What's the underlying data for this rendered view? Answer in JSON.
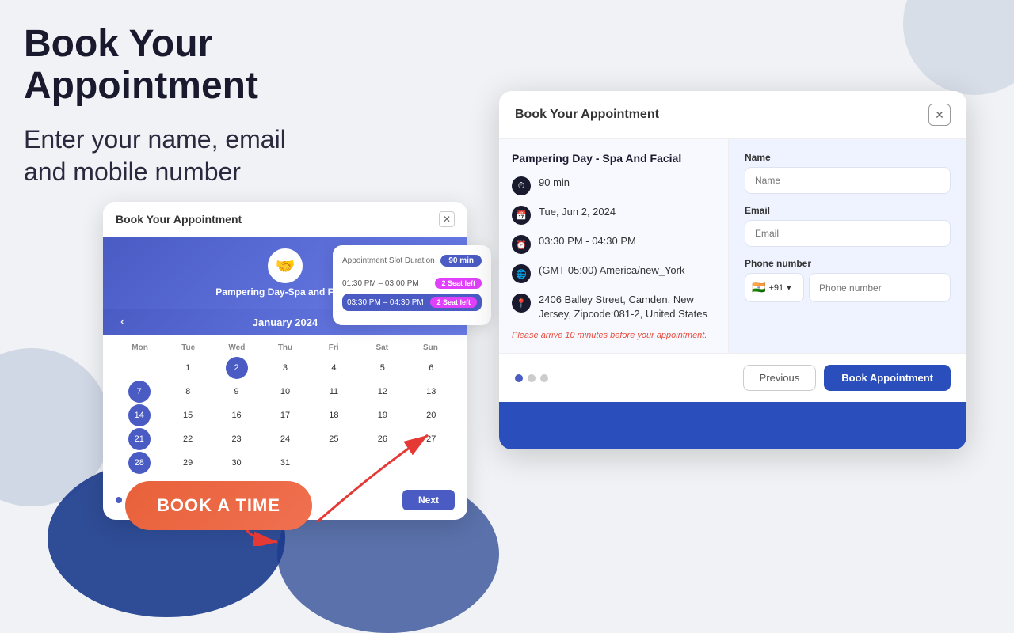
{
  "page": {
    "main_title": "Book Your Appointment",
    "sub_title": "Enter your name, email\nand mobile number",
    "book_btn": "BOOK A TIME"
  },
  "modal_left": {
    "title": "Book Your Appointment",
    "service_name": "Pampering Day-Spa and Facial",
    "month": "January  2024",
    "days_header": [
      "Mon",
      "Tue",
      "Wed",
      "Thu",
      "Fri",
      "Sat",
      "Sun"
    ],
    "days": [
      {
        "n": "",
        "selected": false,
        "highlighted": false
      },
      {
        "n": "1",
        "selected": false,
        "highlighted": false
      },
      {
        "n": "2",
        "selected": true,
        "highlighted": false
      },
      {
        "n": "3",
        "selected": false,
        "highlighted": false
      },
      {
        "n": "4",
        "selected": false,
        "highlighted": false
      },
      {
        "n": "5",
        "selected": false,
        "highlighted": false
      },
      {
        "n": "6",
        "selected": false,
        "highlighted": false
      },
      {
        "n": "7",
        "selected": false,
        "highlighted": true
      },
      {
        "n": "8",
        "selected": false,
        "highlighted": false
      },
      {
        "n": "9",
        "selected": false,
        "highlighted": false
      },
      {
        "n": "10",
        "selected": false,
        "highlighted": false
      },
      {
        "n": "11",
        "selected": false,
        "highlighted": false
      },
      {
        "n": "12",
        "selected": false,
        "highlighted": false
      },
      {
        "n": "13",
        "selected": false,
        "highlighted": false
      },
      {
        "n": "14",
        "selected": false,
        "highlighted": true
      },
      {
        "n": "15",
        "selected": false,
        "highlighted": false
      },
      {
        "n": "16",
        "selected": false,
        "highlighted": false
      },
      {
        "n": "17",
        "selected": false,
        "highlighted": false
      },
      {
        "n": "18",
        "selected": false,
        "highlighted": false
      },
      {
        "n": "19",
        "selected": false,
        "highlighted": false
      },
      {
        "n": "20",
        "selected": false,
        "highlighted": false
      },
      {
        "n": "21",
        "selected": false,
        "highlighted": true
      },
      {
        "n": "22",
        "selected": false,
        "highlighted": false
      },
      {
        "n": "23",
        "selected": false,
        "highlighted": false
      },
      {
        "n": "24",
        "selected": false,
        "highlighted": false
      },
      {
        "n": "25",
        "selected": false,
        "highlighted": false
      },
      {
        "n": "26",
        "selected": false,
        "highlighted": false
      },
      {
        "n": "27",
        "selected": false,
        "highlighted": false
      },
      {
        "n": "28",
        "selected": false,
        "highlighted": true
      },
      {
        "n": "29",
        "selected": false,
        "highlighted": false
      },
      {
        "n": "30",
        "selected": false,
        "highlighted": false
      },
      {
        "n": "31",
        "selected": false,
        "highlighted": false
      }
    ],
    "next_btn": "Next"
  },
  "slots": {
    "title": "Appointment Slot Duration",
    "duration": "90 min",
    "slot1_time": "01:30 PM – 03:00 PM",
    "slot1_badge": "2 Seat left",
    "slot2_time": "03:30 PM – 04:30 PM",
    "slot2_badge": "2 Seat left"
  },
  "modal_right": {
    "title": "Book Your Appointment",
    "service_title": "Pampering Day - Spa And Facial",
    "details": [
      {
        "icon": "⏱",
        "text": "90 min"
      },
      {
        "icon": "📅",
        "text": "Tue, Jun 2, 2024"
      },
      {
        "icon": "⏰",
        "text": "03:30 PM - 04:30 PM"
      },
      {
        "icon": "🌐",
        "text": "(GMT-05:00) America/new_York"
      },
      {
        "icon": "📍",
        "text": "2406 Balley Street, Camden, New Jersey, Zipcode:081-2, United States"
      }
    ],
    "arrive_note": "Please arrive 10 minutes before your appointment.",
    "form": {
      "name_label": "Name",
      "name_placeholder": "Name",
      "email_label": "Email",
      "email_placeholder": "Email",
      "phone_label": "Phone number",
      "phone_flag": "🇮🇳",
      "phone_code": "+91",
      "phone_placeholder": "Phone number"
    },
    "prev_btn": "Previous",
    "book_btn": "Book Appointment"
  }
}
